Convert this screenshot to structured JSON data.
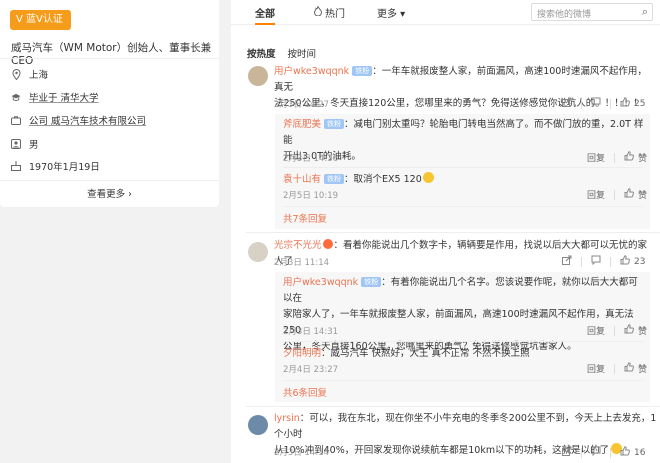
{
  "profile": {
    "badge": "V 蓝V认证",
    "bio": "威马汽车（WM Motor）创始人、董事长兼CEO",
    "location": "上海",
    "school": "毕业于 清华大学",
    "company": "公司 威马汽车技术有限公司",
    "gender": "男",
    "birthday": "1970年1月19日",
    "more": "查看更多 ›"
  },
  "tabs": {
    "all": "全部",
    "hot": "热门",
    "more": "更多 ▾",
    "search_placeholder": "搜索他的微博"
  },
  "sort": {
    "hot": "按热度",
    "time": "按时间"
  },
  "comments": [
    {
      "user": "用户wke3wqqnk",
      "tag": "铁粉",
      "text_line1": "：一年车就报废整人家，前面漏风，高速100时速漏风不起作用，真无",
      "text_line2": "法250公里，冬天直接120公里，您哪里来的勇气？免得送修感觉你说坑人的。！！！！",
      "time": "2月3日 14:27",
      "likes": "25",
      "replies": [
        {
          "user": "斧底肥美",
          "tag": "铁粉",
          "text_line1": "：减电门别太重吗？轮胎电门转电当然高了。而不做门放的重，2.0T 样能",
          "text_line2": "开出3.0T的油耗。",
          "time": "2月3日 14:36",
          "likes": "赞"
        },
        {
          "user": "袁十山有",
          "tag": "铁粉",
          "text_line1": "：取消个EX5 120",
          "text_line2": "",
          "time": "2月5日 10:19",
          "likes": "赞"
        }
      ],
      "more": "共7条回复"
    },
    {
      "user": "光宗不光光",
      "tag": "",
      "text_line1": "：看着你能说出几个数字卡，辆辆要是作用，找说以后大大都可以无忧的家人了",
      "text_line2": "",
      "time": "2月3日 11:14",
      "likes": "23",
      "replies": [
        {
          "user": "用户wke3wqqnk",
          "tag": "铁粉",
          "text_line1": "：有着你能说出几个名字。您该说要作呢，就你以后大大都可以在",
          "text_line2": "家陪家人了，一年车就报废整人家，前面漏风，高速100时速漏风不起作用，真无法250",
          "text_line3": "公里，冬天直接160公里，您哪里来的勇气？免得送修感觉坑害家人。",
          "time": "2月3日 14:31",
          "likes": "赞"
        },
        {
          "user": "夕阳明明",
          "tag": "",
          "text_line1": "：威马汽车 快熬好，大王 真不正常 不然不换上照",
          "text_line2": "",
          "time": "2月4日 23:27",
          "likes": "赞"
        }
      ],
      "more": "共6条回复"
    },
    {
      "user": "lyrsin",
      "tag": "",
      "text_line1": "：可以，我在东北，现在你坐不小牛充电的冬季冬200公里不到，今天上上去发充，1个小时",
      "text_line2": "从10%冲到40%，开回家发现你说续航车都是10km以下的功耗，这就是以的了",
      "time": "2月3日 14:14",
      "likes": "16"
    }
  ],
  "labels": {
    "reply": "回复",
    "like_icon": "thumbs-up"
  },
  "colors": {
    "accent": "#ff8200",
    "username": "#eb7350",
    "badge": "#f59c1a"
  }
}
